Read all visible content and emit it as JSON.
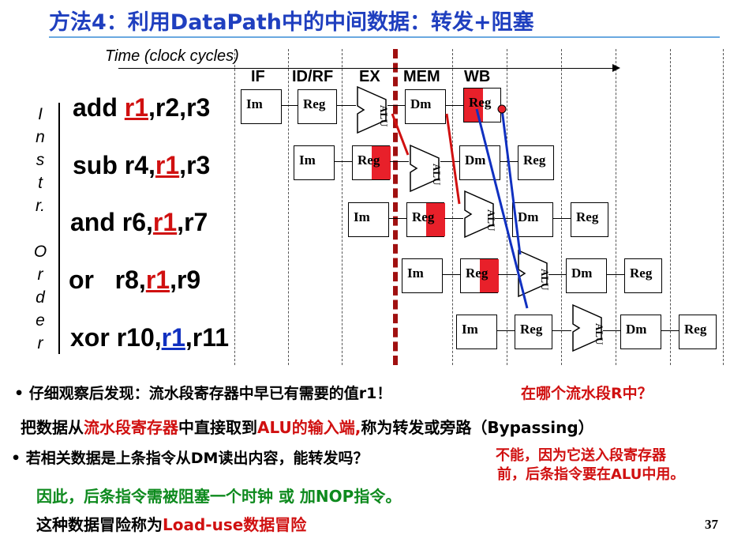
{
  "title": "方法4：利用DataPath中的中间数据：转发+阻塞",
  "time_label": "Time (clock cycles)",
  "stages": [
    "IF",
    "ID/RF",
    "EX",
    "MEM",
    "WB"
  ],
  "order_letters": [
    "I",
    "n",
    "s",
    "t",
    "r.",
    "",
    "O",
    "r",
    "d",
    "e",
    "r"
  ],
  "instructions": [
    {
      "pre": "add ",
      "reg": "r1",
      "post": ",r2,r3",
      "color": "red"
    },
    {
      "pre": "sub r4,",
      "reg": "r1",
      "post": ",r3",
      "color": "red"
    },
    {
      "pre": "and r6,",
      "reg": "r1",
      "post": ",r7",
      "color": "red"
    },
    {
      "pre": "or   r8,",
      "reg": "r1",
      "post": ",r9",
      "color": "red"
    },
    {
      "pre": "xor r10,",
      "reg": "r1",
      "post": ",r11",
      "color": "blue"
    }
  ],
  "block_labels": {
    "im": "Im",
    "reg": "Reg",
    "alu": "ALU",
    "dm": "Dm"
  },
  "bullet1": {
    "prefix": "• 仔细观察后发现：流水段寄存器中早已有需要的值r1！",
    "question": "在哪个流水段R中？"
  },
  "line2": {
    "a": "把数据从",
    "b": "流水段寄存器",
    "c": "中直接取到",
    "d": "ALU的输入端,",
    "e": "称为转发或旁路（Bypassing）"
  },
  "bullet2": "•    若相关数据是上条指令从DM读出内容，能转发吗？",
  "answer": [
    "不能，因为它送入段寄存器",
    "前，后条指令要在ALU中用。"
  ],
  "line4": "因此，后条指令需被阻塞一个时钟 或 加NOP指令。",
  "line5": {
    "a": "这种数据冒险称为",
    "b": "Load-use数据冒险"
  },
  "page_number": "37",
  "colors": {
    "title": "#1f3fbf",
    "highlight": "#e8202a",
    "forward_red": "#d01010",
    "forward_blue": "#1030c0",
    "green": "#0e8a1e"
  }
}
